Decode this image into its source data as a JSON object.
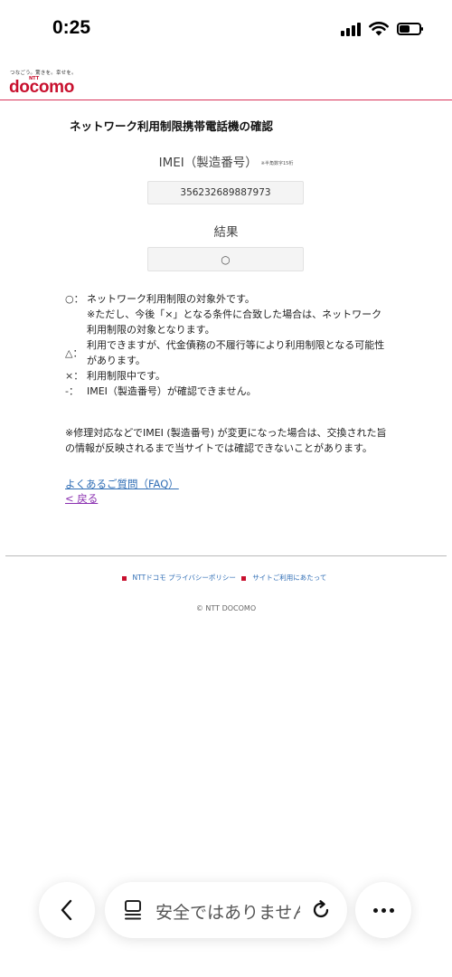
{
  "status_bar": {
    "time": "0:25"
  },
  "header": {
    "tagline": "つなごう。驚きを。幸せを。",
    "logo_small": "NTT",
    "logo": "docomo",
    "brand_color": "#c8102e"
  },
  "main": {
    "title": "ネットワーク利用制限携帯電話機の確認",
    "imei_label": "IMEI（製造番号）",
    "imei_note": "※半角数字15桁",
    "imei_value": "356232689887973",
    "result_label": "結果",
    "result_value": "○"
  },
  "legend": [
    {
      "symbol": "○：",
      "text": "ネットワーク利用制限の対象外です。"
    },
    {
      "symbol": "",
      "text": "※ただし、今後「×」となる条件に合致した場合は、ネットワーク利用制限の対象となります。"
    },
    {
      "symbol": "△：",
      "text": "利用できますが、代金債務の不履行等により利用制限となる可能性があります。"
    },
    {
      "symbol": "×：",
      "text": "利用制限中です。"
    },
    {
      "symbol": "-：",
      "text": "IMEI（製造番号）が確認できません。"
    }
  ],
  "notice": {
    "text": "※修理対応などでIMEI (製造番号) が変更になった場合は、交換された旨の情報が反映されるまで当サイトでは確認できないことがあります。"
  },
  "links": {
    "faq": "よくあるご質問（FAQ）",
    "back": "< 戻る"
  },
  "footer": {
    "privacy": "NTTドコモ プライバシーポリシー",
    "terms": "サイトご利用にあたって",
    "copyright": "© NTT DOCOMO"
  },
  "browser_bar": {
    "url_text": "安全ではありません",
    "icons": [
      "chevron-left-icon",
      "reader-icon",
      "reload-icon",
      "more-icon"
    ]
  }
}
